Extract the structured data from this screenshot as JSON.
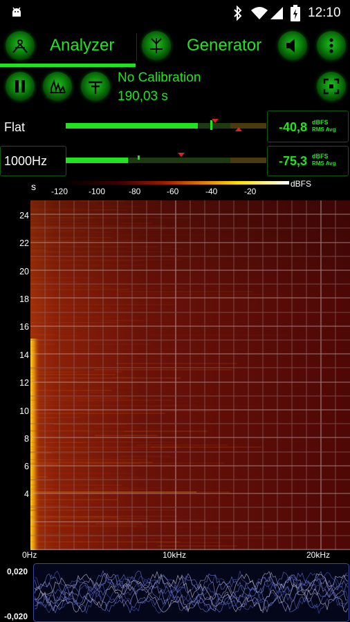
{
  "status_bar": {
    "time": "12:10",
    "icons": [
      "android-debug-icon",
      "bluetooth-icon",
      "wifi-icon",
      "signal-icon",
      "battery-charging-icon"
    ]
  },
  "tabs": {
    "analyzer_label": "Analyzer",
    "generator_label": "Generator",
    "active": "Analyzer"
  },
  "controls": {
    "calibration_text": "No Calibration",
    "elapsed_text": "190,03 s"
  },
  "meters": [
    {
      "label": "Flat",
      "value": "-40,8",
      "unit_top": "dBFS",
      "unit_bottom": "RMS Avg",
      "level": 0.66
    },
    {
      "label": "1000Hz",
      "value": "-75,3",
      "unit_top": "dBFS",
      "unit_bottom": "RMS Avg",
      "level": 0.31
    }
  ],
  "colorbar": {
    "ticks": [
      "-120",
      "-100",
      "-80",
      "-60",
      "-40",
      "-20"
    ],
    "unit": "dBFS"
  },
  "spectrogram": {
    "y_unit": "s",
    "y_ticks": [
      "24",
      "22",
      "20",
      "18",
      "16",
      "14",
      "12",
      "10",
      "8",
      "6",
      "4"
    ],
    "x_ticks": [
      "0Hz",
      "10kHz",
      "20kHz"
    ]
  },
  "waveform": {
    "y_ticks": [
      "0,020",
      "-0,020"
    ]
  },
  "colors": {
    "accent_green": "#1fe51f",
    "spectrogram_base": "#5a0a08",
    "grid": "#8a6a6a"
  }
}
